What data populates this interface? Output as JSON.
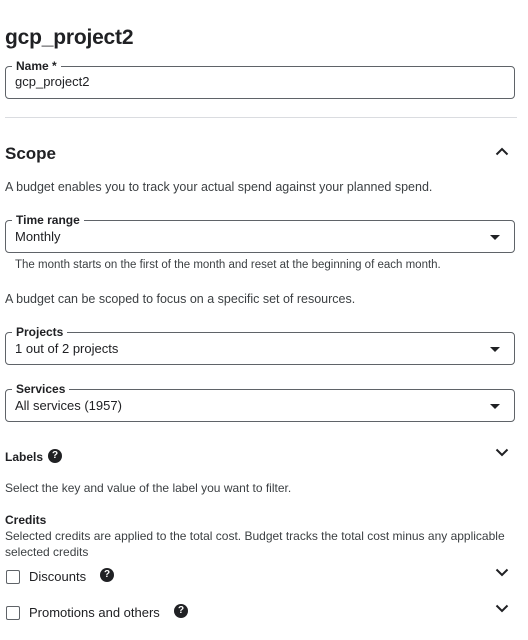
{
  "page": {
    "title": "gcp_project2"
  },
  "name_field": {
    "label": "Name *",
    "value": "gcp_project2"
  },
  "scope": {
    "title": "Scope",
    "description": "A budget enables you to track your actual spend against your planned spend.",
    "time_range": {
      "label": "Time range",
      "value": "Monthly"
    },
    "time_range_hint": "The month starts on the first of the month and reset at the beginning of each month.",
    "resources_description": "A budget can be scoped to focus on a specific set of resources.",
    "projects": {
      "label": "Projects",
      "value": "1 out of 2 projects"
    },
    "services": {
      "label": "Services",
      "value": "All services (1957)"
    }
  },
  "labels": {
    "title": "Labels",
    "description": "Select the key and value of the label you want to filter."
  },
  "credits": {
    "title": "Credits",
    "description_line1": "Selected credits are applied to the total cost. Budget tracks the total cost minus any applicable",
    "description_line2": "selected credits",
    "items": [
      {
        "label": "Discounts",
        "checked": false
      },
      {
        "label": "Promotions and others",
        "checked": false
      }
    ]
  },
  "icons": {
    "help": "help-circle-icon",
    "expand": "chevron-down-icon",
    "collapse": "chevron-up-icon",
    "dropdown": "caret-down-icon"
  },
  "colors": {
    "text": "#202124",
    "border": "#5f6368",
    "divider": "#dadce0"
  }
}
